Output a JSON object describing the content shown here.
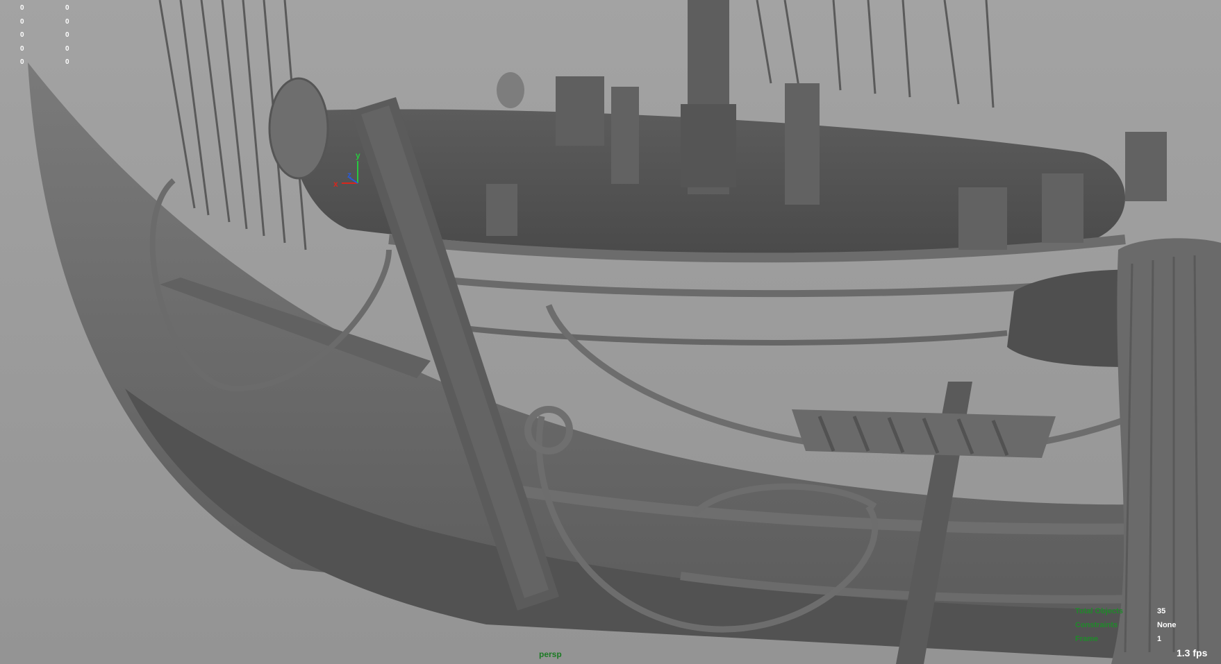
{
  "viewport": {
    "camera_label": "persp",
    "hud_left_columns": [
      [
        "0",
        "0",
        "0",
        "0",
        "0"
      ],
      [
        "0",
        "0",
        "0",
        "0",
        "0"
      ]
    ],
    "hud_right": [
      {
        "label": "Total Objects",
        "value": "35"
      },
      {
        "label": "Constraints",
        "value": "None"
      },
      {
        "label": "Frame",
        "value": "1"
      }
    ],
    "fps": "1.3 fps",
    "axis_labels": {
      "x": "x",
      "y": "y",
      "z": "z"
    },
    "colors": {
      "background": "#9e9e9e",
      "hud_label_green": "#1f8a2a",
      "hud_value": "#ffffff",
      "axis_x": "#d9261c",
      "axis_y": "#27c93f",
      "axis_z": "#2b5bd7"
    }
  }
}
